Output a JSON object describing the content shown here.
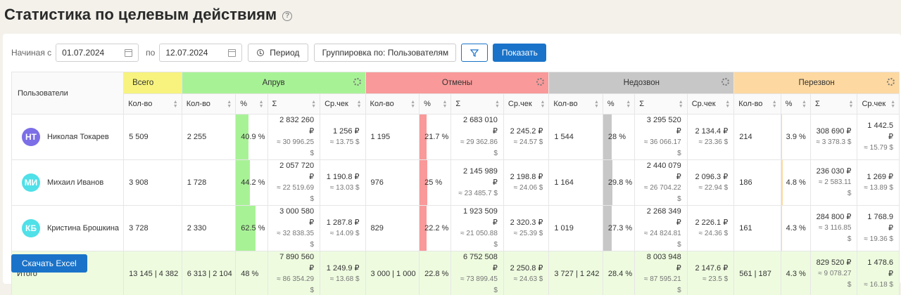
{
  "page": {
    "title": "Статистика по целевым действиям",
    "help_icon": "question-circle-icon"
  },
  "filters": {
    "from_label": "Начиная с",
    "from_value": "01.07.2024",
    "to_label": "по",
    "to_value": "12.07.2024",
    "period_label": "Период",
    "grouping_label": "Группировка по: Пользователям",
    "show_label": "Показать"
  },
  "colors": {
    "total": "#f7f37e",
    "apruv": "#a8f296",
    "cancel": "#f99999",
    "nodial": "#c7c7c7",
    "recall": "#fdd8a0",
    "primary": "#1a73c9"
  },
  "table": {
    "users_header": "Пользователи",
    "groups": {
      "total": "Всего",
      "apruv": "Апрув",
      "cancel": "Отмены",
      "nodial": "Недозвон",
      "recall": "Перезвон"
    },
    "sub": {
      "count": "Кол-во",
      "pct": "%",
      "sum": "Σ",
      "avg": "Ср.чек"
    },
    "rows": [
      {
        "initials": "НТ",
        "avatar_color": "#7b6ee6",
        "name": "Николая Токарев",
        "total": "5 509",
        "apruv": {
          "count": "2 255",
          "pct": "40.9 %",
          "pct_value": 40.9,
          "sum": "2 832 260 ₽",
          "sum2": "≈ 30 996.25 $",
          "avg": "1 256 ₽",
          "avg2": "≈ 13.75 $"
        },
        "cancel": {
          "count": "1 195",
          "pct": "21.7 %",
          "pct_value": 21.7,
          "sum": "2 683 010 ₽",
          "sum2": "≈ 29 362.86 $",
          "avg": "2 245.2 ₽",
          "avg2": "≈ 24.57 $"
        },
        "nodial": {
          "count": "1 544",
          "pct": "28 %",
          "pct_value": 28,
          "sum": "3 295 520 ₽",
          "sum2": "≈ 36 066.17 $",
          "avg": "2 134.4 ₽",
          "avg2": "≈ 23.36 $"
        },
        "recall": {
          "count": "214",
          "pct": "3.9 %",
          "pct_value": 3.9,
          "sum": "308 690 ₽",
          "sum2": "≈ 3 378.3 $",
          "avg": "1 442.5 ₽",
          "avg2": "≈ 15.79 $"
        }
      },
      {
        "initials": "МИ",
        "avatar_color": "#4fe0e8",
        "name": "Михаил Иванов",
        "total": "3 908",
        "apruv": {
          "count": "1 728",
          "pct": "44.2 %",
          "pct_value": 44.2,
          "sum": "2 057 720 ₽",
          "sum2": "≈ 22 519.69 $",
          "avg": "1 190.8 ₽",
          "avg2": "≈ 13.03 $"
        },
        "cancel": {
          "count": "976",
          "pct": "25 %",
          "pct_value": 25,
          "sum": "2 145 989 ₽",
          "sum2": "≈ 23 485.7 $",
          "avg": "2 198.8 ₽",
          "avg2": "≈ 24.06 $"
        },
        "nodial": {
          "count": "1 164",
          "pct": "29.8 %",
          "pct_value": 29.8,
          "sum": "2 440 079 ₽",
          "sum2": "≈ 26 704.22 $",
          "avg": "2 096.3 ₽",
          "avg2": "≈ 22.94 $"
        },
        "recall": {
          "count": "186",
          "pct": "4.8 %",
          "pct_value": 4.8,
          "sum": "236 030 ₽",
          "sum2": "≈ 2 583.11 $",
          "avg": "1 269 ₽",
          "avg2": "≈ 13.89 $"
        }
      },
      {
        "initials": "КБ",
        "avatar_color": "#4fe0e8",
        "name": "Кристина Брошкина",
        "total": "3 728",
        "apruv": {
          "count": "2 330",
          "pct": "62.5 %",
          "pct_value": 62.5,
          "sum": "3 000 580 ₽",
          "sum2": "≈ 32 838.35 $",
          "avg": "1 287.8 ₽",
          "avg2": "≈ 14.09 $"
        },
        "cancel": {
          "count": "829",
          "pct": "22.2 %",
          "pct_value": 22.2,
          "sum": "1 923 509 ₽",
          "sum2": "≈ 21 050.88 $",
          "avg": "2 320.3 ₽",
          "avg2": "≈ 25.39 $"
        },
        "nodial": {
          "count": "1 019",
          "pct": "27.3 %",
          "pct_value": 27.3,
          "sum": "2 268 349 ₽",
          "sum2": "≈ 24 824.81 $",
          "avg": "2 226.1 ₽",
          "avg2": "≈ 24.36 $"
        },
        "recall": {
          "count": "161",
          "pct": "4.3 %",
          "pct_value": 4.3,
          "sum": "284 800 ₽",
          "sum2": "≈ 3 116.85 $",
          "avg": "1 768.9 ₽",
          "avg2": "≈ 19.36 $"
        }
      }
    ],
    "totals": {
      "label": "Итого",
      "total": "13 145 | 4 382",
      "apruv": {
        "count": "6 313 | 2 104",
        "pct": "48 %",
        "sum": "7 890 560 ₽",
        "sum2": "≈ 86 354.29 $",
        "avg": "1 249.9 ₽",
        "avg2": "≈ 13.68 $"
      },
      "cancel": {
        "count": "3 000 | 1 000",
        "pct": "22.8 %",
        "sum": "6 752 508 ₽",
        "sum2": "≈ 73 899.45 $",
        "avg": "2 250.8 ₽",
        "avg2": "≈ 24.63 $"
      },
      "nodial": {
        "count": "3 727 | 1 242",
        "pct": "28.4 %",
        "sum": "8 003 948 ₽",
        "sum2": "≈ 87 595.21 $",
        "avg": "2 147.6 ₽",
        "avg2": "≈ 23.5 $"
      },
      "recall": {
        "count": "561 | 187",
        "pct": "4.3 %",
        "sum": "829 520 ₽",
        "sum2": "≈ 9 078.27 $",
        "avg": "1 478.6 ₽",
        "avg2": "≈ 16.18 $"
      }
    }
  },
  "excel_label": "Скачать Excel"
}
